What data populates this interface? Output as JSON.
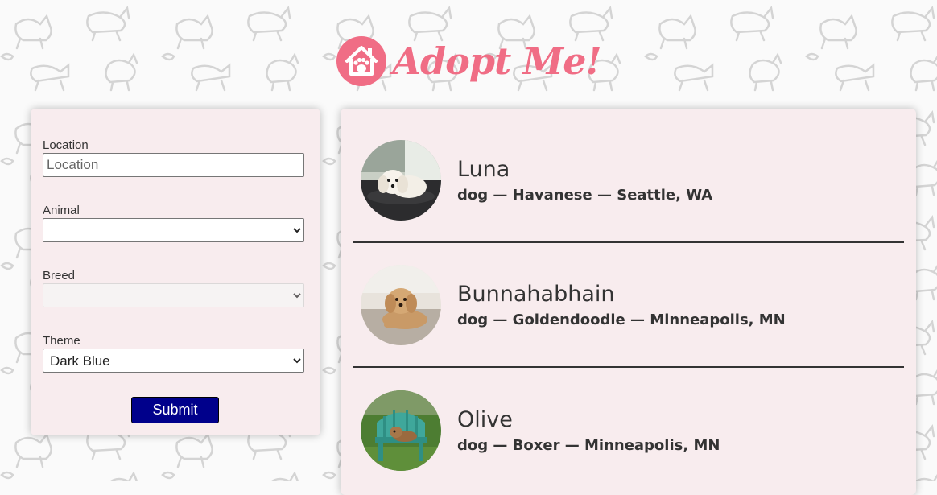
{
  "app": {
    "title": "Adopt Me!"
  },
  "search": {
    "location": {
      "label": "Location",
      "placeholder": "Location",
      "value": ""
    },
    "animal": {
      "label": "Animal",
      "selected": ""
    },
    "breed": {
      "label": "Breed",
      "selected": ""
    },
    "theme": {
      "label": "Theme",
      "selected": "Dark Blue"
    },
    "submit_label": "Submit",
    "submit_color": "#00008b"
  },
  "pets": [
    {
      "name": "Luna",
      "description": "dog — Havanese — Seattle, WA"
    },
    {
      "name": "Bunnahabhain",
      "description": "dog — Goldendoodle — Minneapolis, MN"
    },
    {
      "name": "Olive",
      "description": "dog — Boxer — Minneapolis, MN"
    }
  ],
  "colors": {
    "brand": "#f06d85",
    "panel": "#f8ecee",
    "button": "#00008b"
  }
}
